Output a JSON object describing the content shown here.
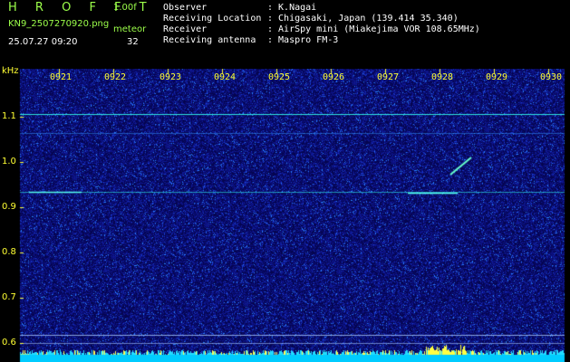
{
  "header": {
    "app_title": "H R O F F T",
    "version": "1.00f",
    "filename": "KN9_2507270920.png",
    "meteor_label": "meteor",
    "datetime": "25.07.27 09:20",
    "meteor_count": "32",
    "info": [
      {
        "key": "Observer",
        "value": ": K.Nagai"
      },
      {
        "key": "Receiving Location",
        "value": ": Chigasaki, Japan (139.414 35.340)"
      },
      {
        "key": "Receiver",
        "value": ": AirSpy mini (Miakejima VOR 108.65MHz)"
      },
      {
        "key": "Receiving antenna",
        "value": ": Maspro FM-3"
      }
    ]
  },
  "axes": {
    "y_unit": "kHz",
    "y_ticks": [
      "1.1",
      "1.0",
      "0.9",
      "0.8",
      "0.7",
      "0.6"
    ],
    "x_ticks": [
      "0921",
      "0922",
      "0923",
      "0924",
      "0925",
      "0926",
      "0927",
      "0928",
      "0929",
      "0930"
    ]
  },
  "colors": {
    "background": "#000000",
    "waterfall_bg": "#0a0a6e",
    "signal_line": "#33ffee",
    "label_yellow": "#ffff33",
    "label_green": "#9cff4a"
  }
}
